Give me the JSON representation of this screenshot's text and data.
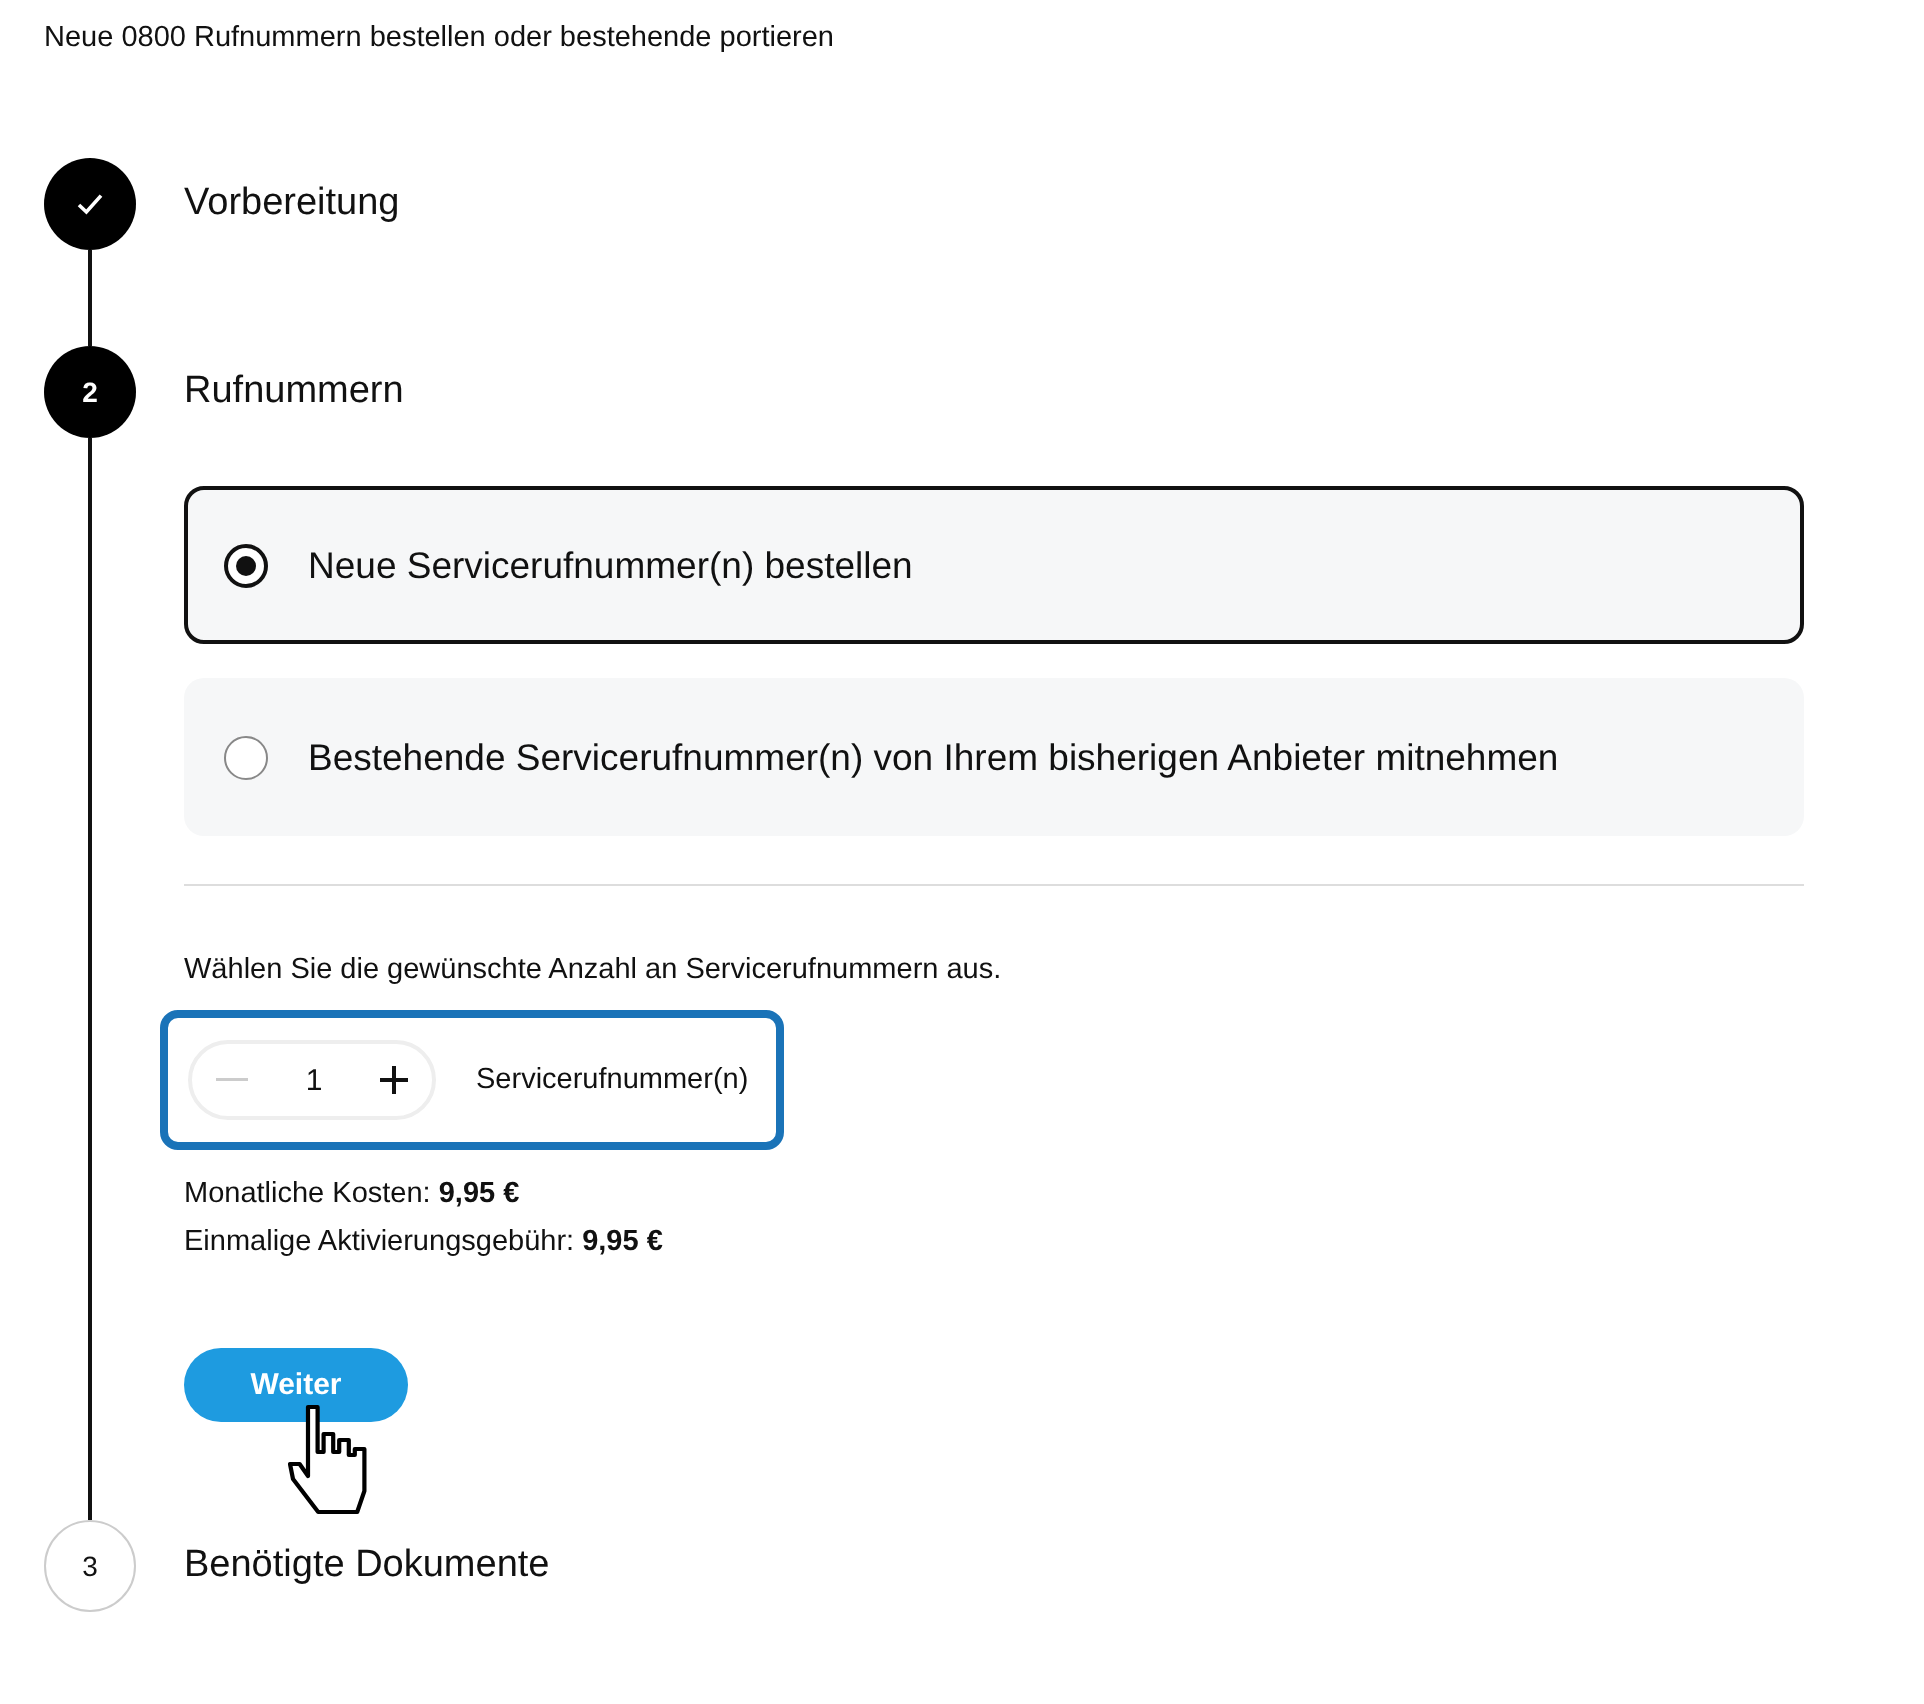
{
  "header": "Neue 0800 Rufnummern bestellen oder bestehende portieren",
  "steps": [
    {
      "title": "Vorbereitung",
      "completed": true,
      "current": false
    },
    {
      "marker": "2",
      "title": "Rufnummern",
      "completed": false,
      "current": true
    },
    {
      "marker": "3",
      "title": "Benötigte Dokumente",
      "completed": false,
      "current": false
    }
  ],
  "options": [
    {
      "label": "Neue Servicerufnummer(n) bestellen",
      "selected": true
    },
    {
      "label": "Bestehende Servicerufnummer(n) von Ihrem bisherigen Anbieter mitnehmen",
      "selected": false
    }
  ],
  "instruction": "Wählen Sie die gewünschte Anzahl an Servicerufnummern aus.",
  "quantity": {
    "value": "1",
    "unit": "Servicerufnummer(n)",
    "decrease_disabled": true,
    "focused": true
  },
  "costs": [
    "Monatliche Kosten: **9,95 €**",
    "Einmalige Aktivierungsgebühr: **9,95 €**"
  ],
  "button": "Weiter"
}
